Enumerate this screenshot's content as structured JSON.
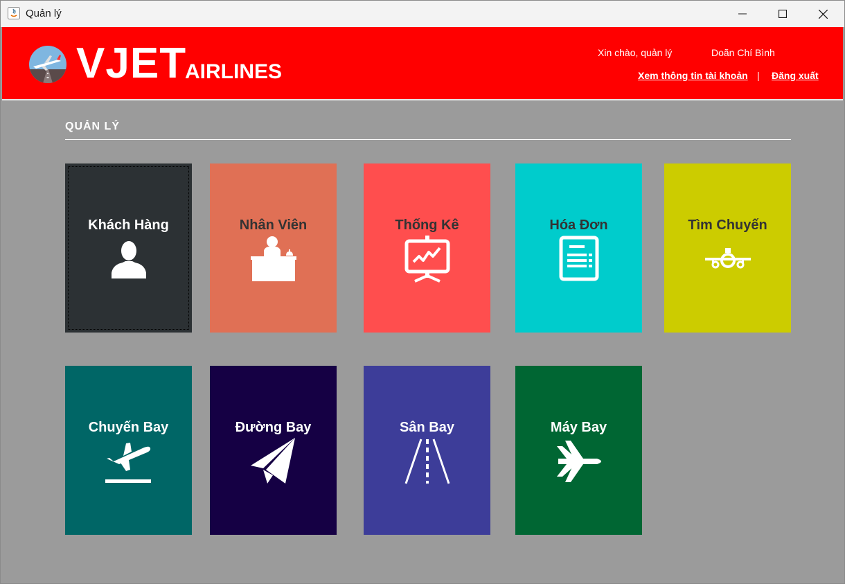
{
  "window": {
    "title": "Quản lý"
  },
  "header": {
    "brand_main": "VJET",
    "brand_sub": "AIRLINES",
    "greeting": "Xin chào,  quản lý",
    "user_name": "Doãn Chí Bình",
    "account_link": "Xem thông tin tài khoản",
    "separator": "|",
    "logout_link": "Đăng xuất",
    "background": "#ff0000"
  },
  "section": {
    "title": "QUẢN LÝ"
  },
  "tiles": [
    {
      "label": "Khách Hàng",
      "icon": "customer-icon",
      "color": "#2c3134",
      "text_color": "#ffffff"
    },
    {
      "label": "Nhân Viên",
      "icon": "employee-icon",
      "color": "#e07055",
      "text_color": "#333333"
    },
    {
      "label": "Thống Kê",
      "icon": "statistics-icon",
      "color": "#ff4e4e",
      "text_color": "#333333"
    },
    {
      "label": "Hóa Đơn",
      "icon": "invoice-icon",
      "color": "#00cccc",
      "text_color": "#333333"
    },
    {
      "label": "Tìm Chuyến",
      "icon": "search-flight-icon",
      "color": "#cccc00",
      "text_color": "#333333"
    },
    {
      "label": "Chuyến Bay",
      "icon": "flight-departure-icon",
      "color": "#006666",
      "text_color": "#ffffff"
    },
    {
      "label": "Đường Bay",
      "icon": "route-icon",
      "color": "#150044",
      "text_color": "#ffffff"
    },
    {
      "label": "Sân Bay",
      "icon": "runway-icon",
      "color": "#3d3d99",
      "text_color": "#ffffff"
    },
    {
      "label": "Máy Bay",
      "icon": "airplane-icon",
      "color": "#006633",
      "text_color": "#ffffff"
    }
  ]
}
